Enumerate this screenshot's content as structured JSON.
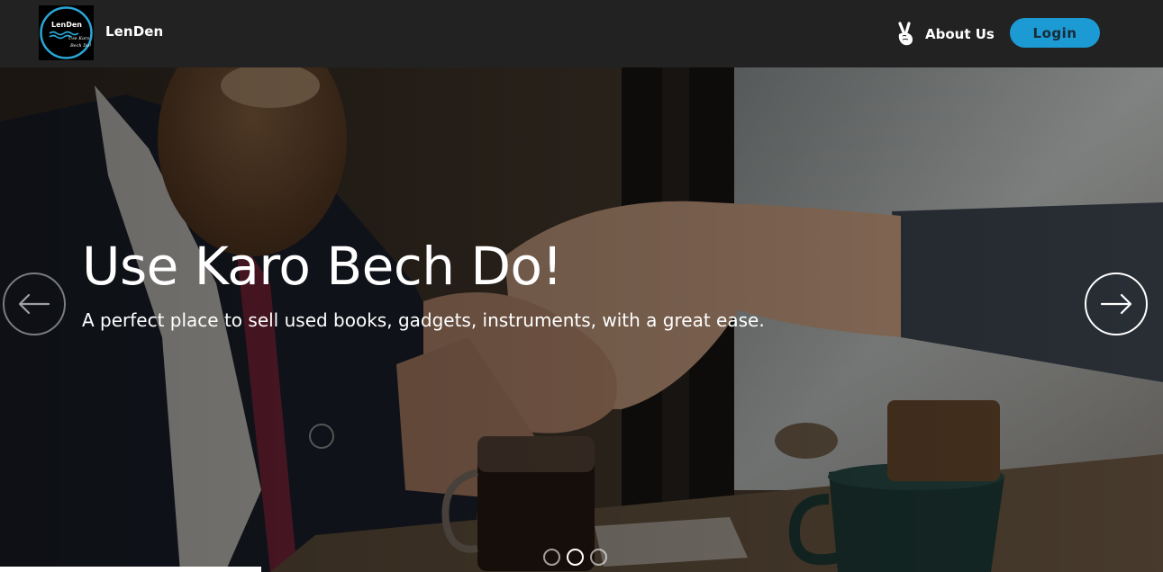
{
  "navbar": {
    "brand": "LenDen",
    "logo_text": {
      "title": "LenDen",
      "tagline_1": "Use Karo",
      "tagline_2": "Bech Do!"
    },
    "about_label": "About Us",
    "about_icon": "victory-hand-icon",
    "login_label": "Login",
    "accent_color": "#1b9ad4"
  },
  "hero": {
    "title": "Use Karo Bech Do!",
    "subtitle": "A perfect place to sell used books, gadgets, instruments, with a great ease.",
    "prev_icon": "arrow-left-icon",
    "next_icon": "arrow-right-icon",
    "slides": [
      {
        "active": false
      },
      {
        "active": true
      },
      {
        "active": false
      }
    ]
  }
}
